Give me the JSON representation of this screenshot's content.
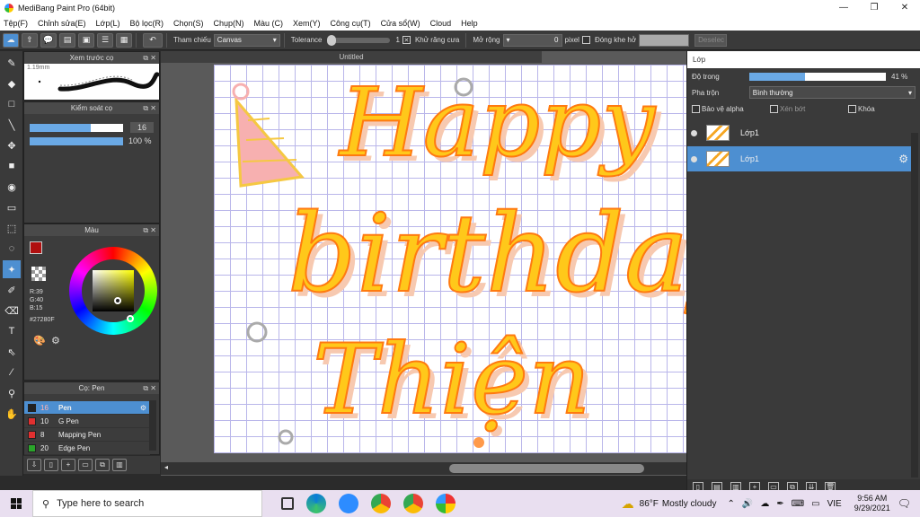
{
  "title_bar": {
    "title": "MediBang Paint Pro (64bit)",
    "minimize": "—",
    "maximize": "❐",
    "close": "✕"
  },
  "menu": [
    "Tệp(F)",
    "Chỉnh sửa(E)",
    "Lớp(L)",
    "Bộ lọc(R)",
    "Chọn(S)",
    "Chụp(N)",
    "Màu (C)",
    "Xem(Y)",
    "Công cụ(T)",
    "Cửa sổ(W)",
    "Cloud",
    "Help"
  ],
  "toolbar": {
    "reference_label": "Tham chiếu",
    "reference_value": "Canvas",
    "tolerance_label": "Tolerance",
    "tolerance_value": "1",
    "antialias_label": "Khử răng cưa",
    "antialias_checked": true,
    "expand_label": "Mở rộng",
    "expand_value": "0",
    "expand_unit": "pixel",
    "close_gap_label": "Đóng khe hở",
    "deselect_label": "Deselec"
  },
  "panels": {
    "preview": {
      "title": "Xem trước cọ",
      "size_label": "1.19mm"
    },
    "brush_control": {
      "title": "Kiểm soát cọ",
      "size_value": "16",
      "size_fraction": 0.65,
      "opacity_value": "100 %",
      "opacity_fraction": 1.0
    },
    "color": {
      "title": "Màu",
      "r": "R:39",
      "g": "G:40",
      "b": "B:15",
      "hex": "#27280F",
      "fg_color": "#b01010"
    },
    "brush_list": {
      "title": "Cọ: Pen",
      "items": [
        {
          "size": "16",
          "name": "Pen",
          "color": "#222222",
          "selected": true
        },
        {
          "size": "10",
          "name": "G Pen",
          "color": "#e03030",
          "selected": false
        },
        {
          "size": "8",
          "name": "Mapping Pen",
          "color": "#e03030",
          "selected": false
        },
        {
          "size": "20",
          "name": "Edge Pen",
          "color": "#2aa52a",
          "selected": false
        }
      ]
    }
  },
  "canvas": {
    "tab_title": "Untitled",
    "lines": [
      "Happy",
      "birthday",
      "Thiện"
    ],
    "colors": {
      "orange": "#ff7a10",
      "yellow": "#ffc81a",
      "shadow": "#f7c9b0",
      "grid": "#b9b6ea"
    }
  },
  "layers_panel": {
    "title": "Lớp",
    "opacity_label": "Độ trong",
    "opacity_value": "41 %",
    "opacity_fraction": 0.41,
    "blend_label": "Pha trộn",
    "blend_value": "Bình thường",
    "protect_alpha": "Bảo vệ alpha",
    "clipping": "Xén bớt",
    "lock": "Khóa",
    "layers": [
      {
        "name": "Lớp1",
        "selected": false
      },
      {
        "name": "Lớp1",
        "selected": true
      }
    ]
  },
  "taskbar": {
    "search_placeholder": "Type here to search",
    "weather_temp": "86°F",
    "weather_text": "Mostly cloudy",
    "language": "VIE",
    "time": "9:56 AM",
    "date": "9/29/2021"
  }
}
